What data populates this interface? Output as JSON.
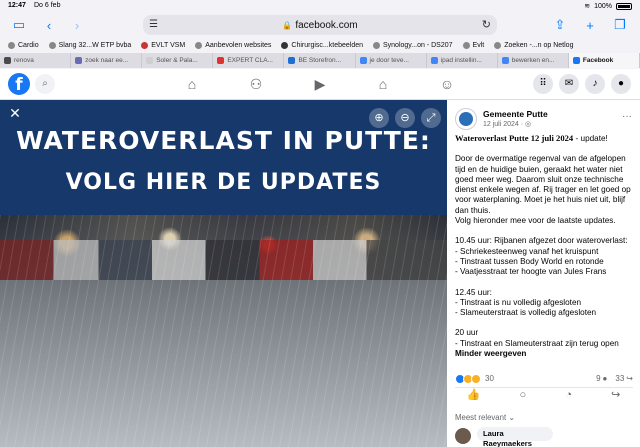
{
  "status_bar": {
    "time": "12:47",
    "date": "Do 6 feb",
    "battery": "100%"
  },
  "browser": {
    "url": "facebook.com",
    "bookmarks": [
      "Cardio",
      "Slang 32...W ETP bvba",
      "EVLT VSM",
      "Aanbevolen websites",
      "Chirurgisc...ktebeelden",
      "Synology...on - DS207",
      "Evlt",
      "Zoeken -...n op Netlog"
    ],
    "tabs": [
      {
        "label": "renova",
        "color": "#4a4a4a"
      },
      {
        "label": "zoek naar ee...",
        "color": "#6b6bb5"
      },
      {
        "label": "Soler & Pala...",
        "color": "#cfcfcf"
      },
      {
        "label": "EXPERT CLA...",
        "color": "#e03030"
      },
      {
        "label": "BE Storefron...",
        "color": "#1f6fd1"
      },
      {
        "label": "je door teve...",
        "color": "#4285f4"
      },
      {
        "label": "ipad instellin...",
        "color": "#4285f4"
      },
      {
        "label": "bewerken en...",
        "color": "#4285f4"
      },
      {
        "label": "Facebook",
        "color": "#1877f2"
      }
    ]
  },
  "fb": {
    "logo": "f",
    "nav_icons": [
      "home-icon",
      "friends-icon",
      "watch-icon",
      "marketplace-icon",
      "groups-icon"
    ],
    "right_icons": [
      "menu-grid-icon",
      "messenger-icon",
      "notifications-icon",
      "profile-icon"
    ]
  },
  "photo": {
    "line1": "WATEROVERLAST IN PUTTE:",
    "line2": "VOLG HIER DE UPDATES"
  },
  "post": {
    "author": "Gemeente Putte",
    "date": "12 juli 2024 · ",
    "headline": "Wateroverlast Putte 12 juli 2024",
    "headline_suffix": " - update!",
    "intro": "Door de overmatige regenval van de afgelopen tijd en de huidige buien, geraakt het water niet goed meer weg. Daarom sluit onze technische dienst enkele wegen af. Rij trager en let goed op voor waterplaning. Moet je het huis niet uit, blijf dan thuis.",
    "intro2": "Volg hieronder mee voor de laatste updates.",
    "u1_title": "10.45 uur: Rijbanen afgezet door wateroverlast:",
    "u1_l1": "- Schriekesteenweg vanaf het kruispunt",
    "u1_l2": "- Tinstraat tussen Body World en rotonde",
    "u1_l3": "- Vaatjesstraat ter hoogte van Jules Frans",
    "u2_title": "12.45 uur:",
    "u2_l1": "- Tinstraat is nu volledig afgesloten",
    "u2_l2": "- Slameuterstraat is volledig afgesloten",
    "u3_title": "20 uur",
    "u3_l1": "- Tinstraat en Slameuterstraat zijn terug open",
    "more": "Minder weergeven",
    "reactions_count": "30",
    "comments_count": "9",
    "shares_count": "33",
    "sort": "Meest relevant",
    "first_commenter": "Laura Raeymaekers"
  }
}
